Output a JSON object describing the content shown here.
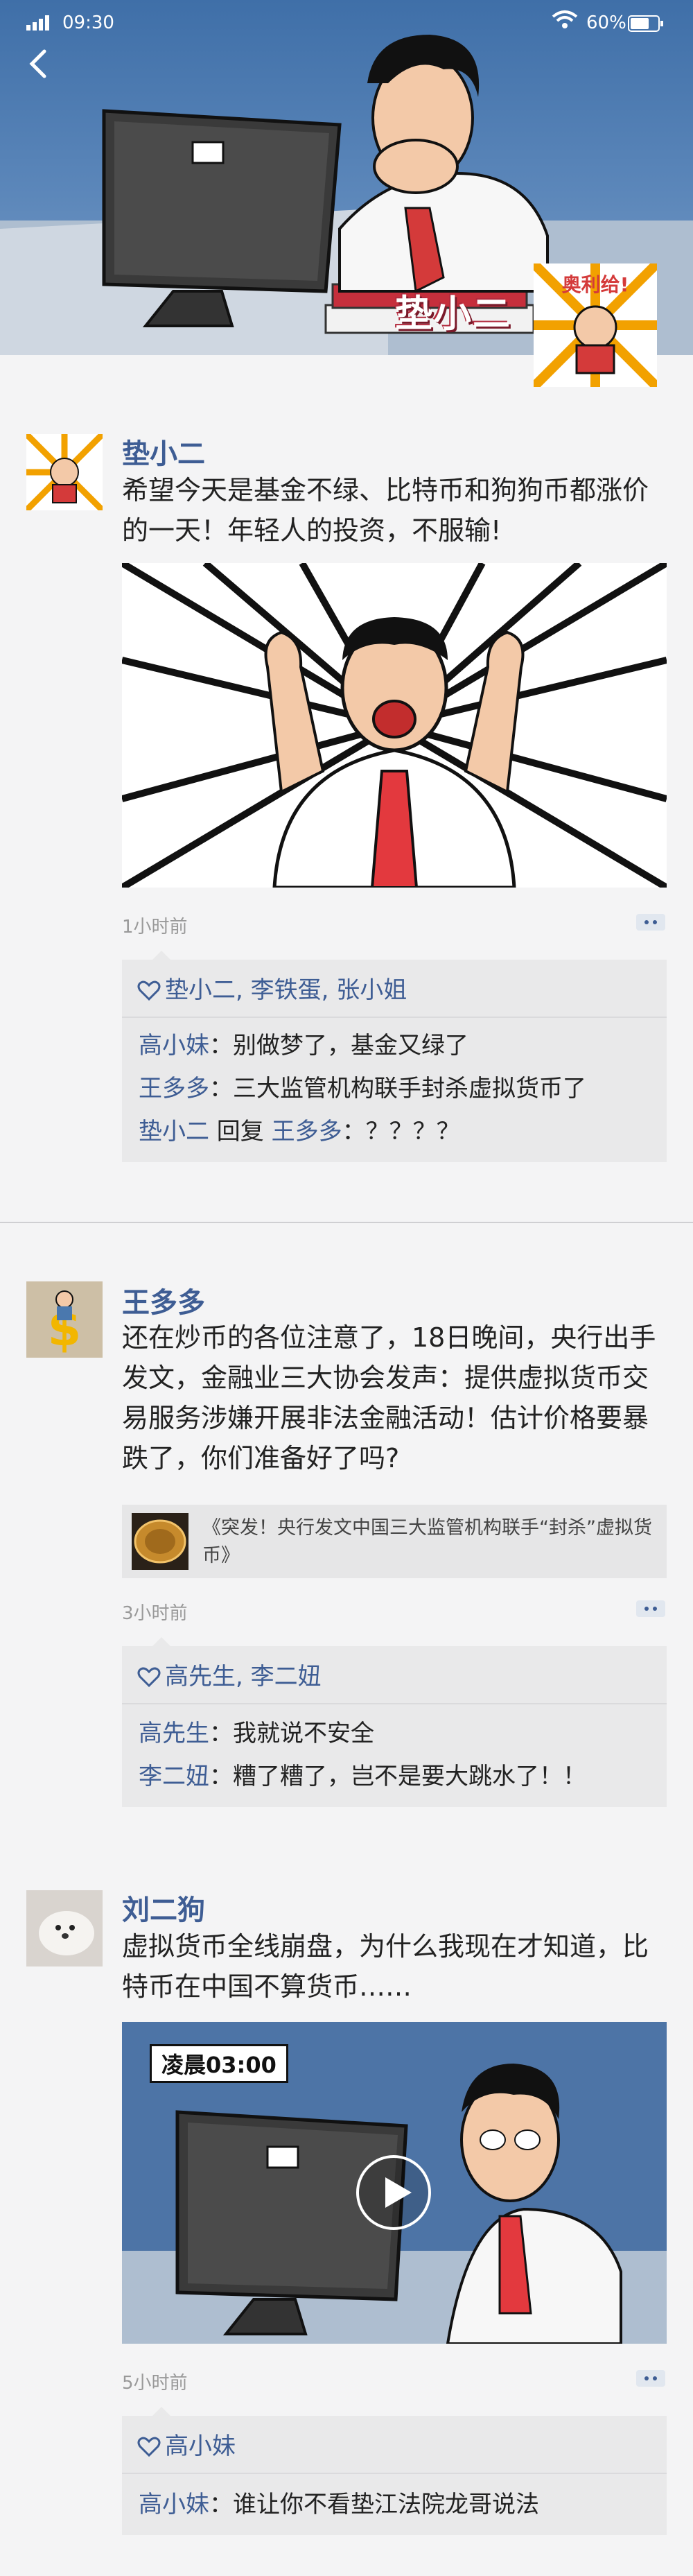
{
  "status_bar": {
    "time": "09:30",
    "battery": "60%"
  },
  "header": {
    "cover_name": "垫小二",
    "cover_badge": "奥利给!"
  },
  "posts": [
    {
      "author": "垫小二",
      "text": "希望今天是基金不绿、比特币和狗狗币都涨价的一天！年轻人的投资，不服输!",
      "time": "1小时前",
      "likes": "垫小二, 李铁蛋, 张小姐",
      "comments": [
        {
          "name": "高小妹",
          "sep": "：",
          "text": "别做梦了，基金又绿了"
        },
        {
          "name": "王多多",
          "sep": "：",
          "text": "三大监管机构联手封杀虚拟货币了"
        },
        {
          "name": "垫小二",
          "reply_word": " 回复 ",
          "reply_to": "王多多",
          "sep": "：",
          "text": "？？？？"
        }
      ]
    },
    {
      "author": "王多多",
      "text": "还在炒币的各位注意了，18日晚间，央行出手发文，金融业三大协会发声：提供虚拟货币交易服务涉嫌开展非法金融活动！估计价格要暴跌了，你们准备好了吗?",
      "link_title": "《突发！央行发文中国三大监管机构联手“封杀”虚拟货币》",
      "time": "3小时前",
      "likes": "高先生, 李二妞",
      "comments": [
        {
          "name": "高先生",
          "sep": "：",
          "text": "我就说不安全"
        },
        {
          "name": "李二妞",
          "sep": "：",
          "text": "糟了糟了，岂不是要大跳水了！！"
        }
      ]
    },
    {
      "author": "刘二狗",
      "text": "虚拟货币全线崩盘，为什么我现在才知道，比特币在中国不算货币……",
      "video_label": "凌晨03:00",
      "time": "5小时前",
      "likes": "高小妹",
      "comments": [
        {
          "name": "高小妹",
          "sep": "：",
          "text": "谁让你不看垫江法院龙哥说法"
        }
      ]
    }
  ],
  "icons": [
    "signal-icon",
    "wifi-icon",
    "battery-icon",
    "back-arrow-icon",
    "heart-icon",
    "more-dots-icon",
    "play-icon"
  ],
  "colors": {
    "accent": "#3e5d94",
    "header_blue": "#4a78ae",
    "comment_bg": "#e9e9ea",
    "page_bg": "#f4f4f5"
  }
}
